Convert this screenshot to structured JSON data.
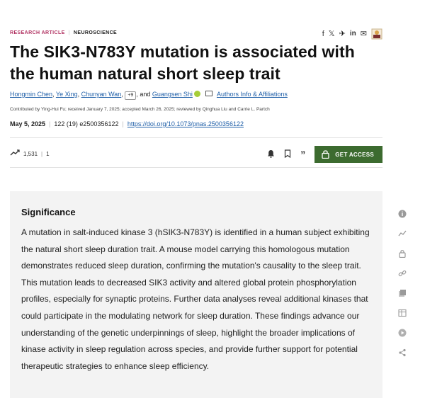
{
  "header": {
    "article_type": "RESEARCH ARTICLE",
    "section": "NEUROSCIENCE",
    "share_icons": [
      "facebook-icon",
      "x-icon",
      "bluesky-icon",
      "linkedin-icon",
      "email-icon",
      "share-cover-icon"
    ],
    "share_glyphs": {
      "facebook": "f",
      "x": "𝕏",
      "bluesky": "✈",
      "linkedin": "in",
      "email": "✉"
    }
  },
  "title": "The SIK3-N783Y mutation is associated with the human natural short sleep trait",
  "authors": {
    "names": [
      "Hongmin Chen",
      "Ye Xing",
      "Chunyan Wan"
    ],
    "more_badge": "+9",
    "and_text": ", and",
    "last_author": "Guangsen Shi",
    "info_link": "Authors Info & Affiliations"
  },
  "contributed": "Contributed by Ying-Hui Fu; received January 7, 2025; accepted March 26, 2025; reviewed by Qinghua Liu and Carrie L. Partch",
  "publication": {
    "date": "May 5, 2025",
    "citation": "122 (19) e2500356122",
    "doi": "https://doi.org/10.1073/pnas.2500356122"
  },
  "metrics": {
    "views": "1,531",
    "separator": "|",
    "citations": "1"
  },
  "actions": {
    "get_access_label": "GET ACCESS"
  },
  "significance": {
    "heading": "Significance",
    "body": "A mutation in salt-induced kinase 3 (hSIK3-N783Y) is identified in a human subject exhibiting the natural short sleep duration trait. A mouse model carrying this homologous mutation demonstrates reduced sleep duration, confirming the mutation's causality to the sleep trait. This mutation leads to decreased SIK3 activity and altered global protein phosphorylation profiles, especially for synaptic proteins. Further data analyses reveal additional kinases that could participate in the modulating network for sleep duration. These findings advance our understanding of the genetic underpinnings of sleep, highlight the broader implications of kinase activity in sleep regulation across species, and provide further support for potential therapeutic strategies to enhance sleep efficiency."
  },
  "right_rail": [
    "info-icon",
    "metrics-icon",
    "lock-icon",
    "link-icon",
    "figures-icon",
    "tables-icon",
    "media-icon",
    "share-icon"
  ],
  "colors": {
    "access_button": "#3c6b2f",
    "link": "#1f5fa8",
    "article_type": "#b03060",
    "significance_bg": "#f3f3f3",
    "orcid": "#a6ce39"
  }
}
